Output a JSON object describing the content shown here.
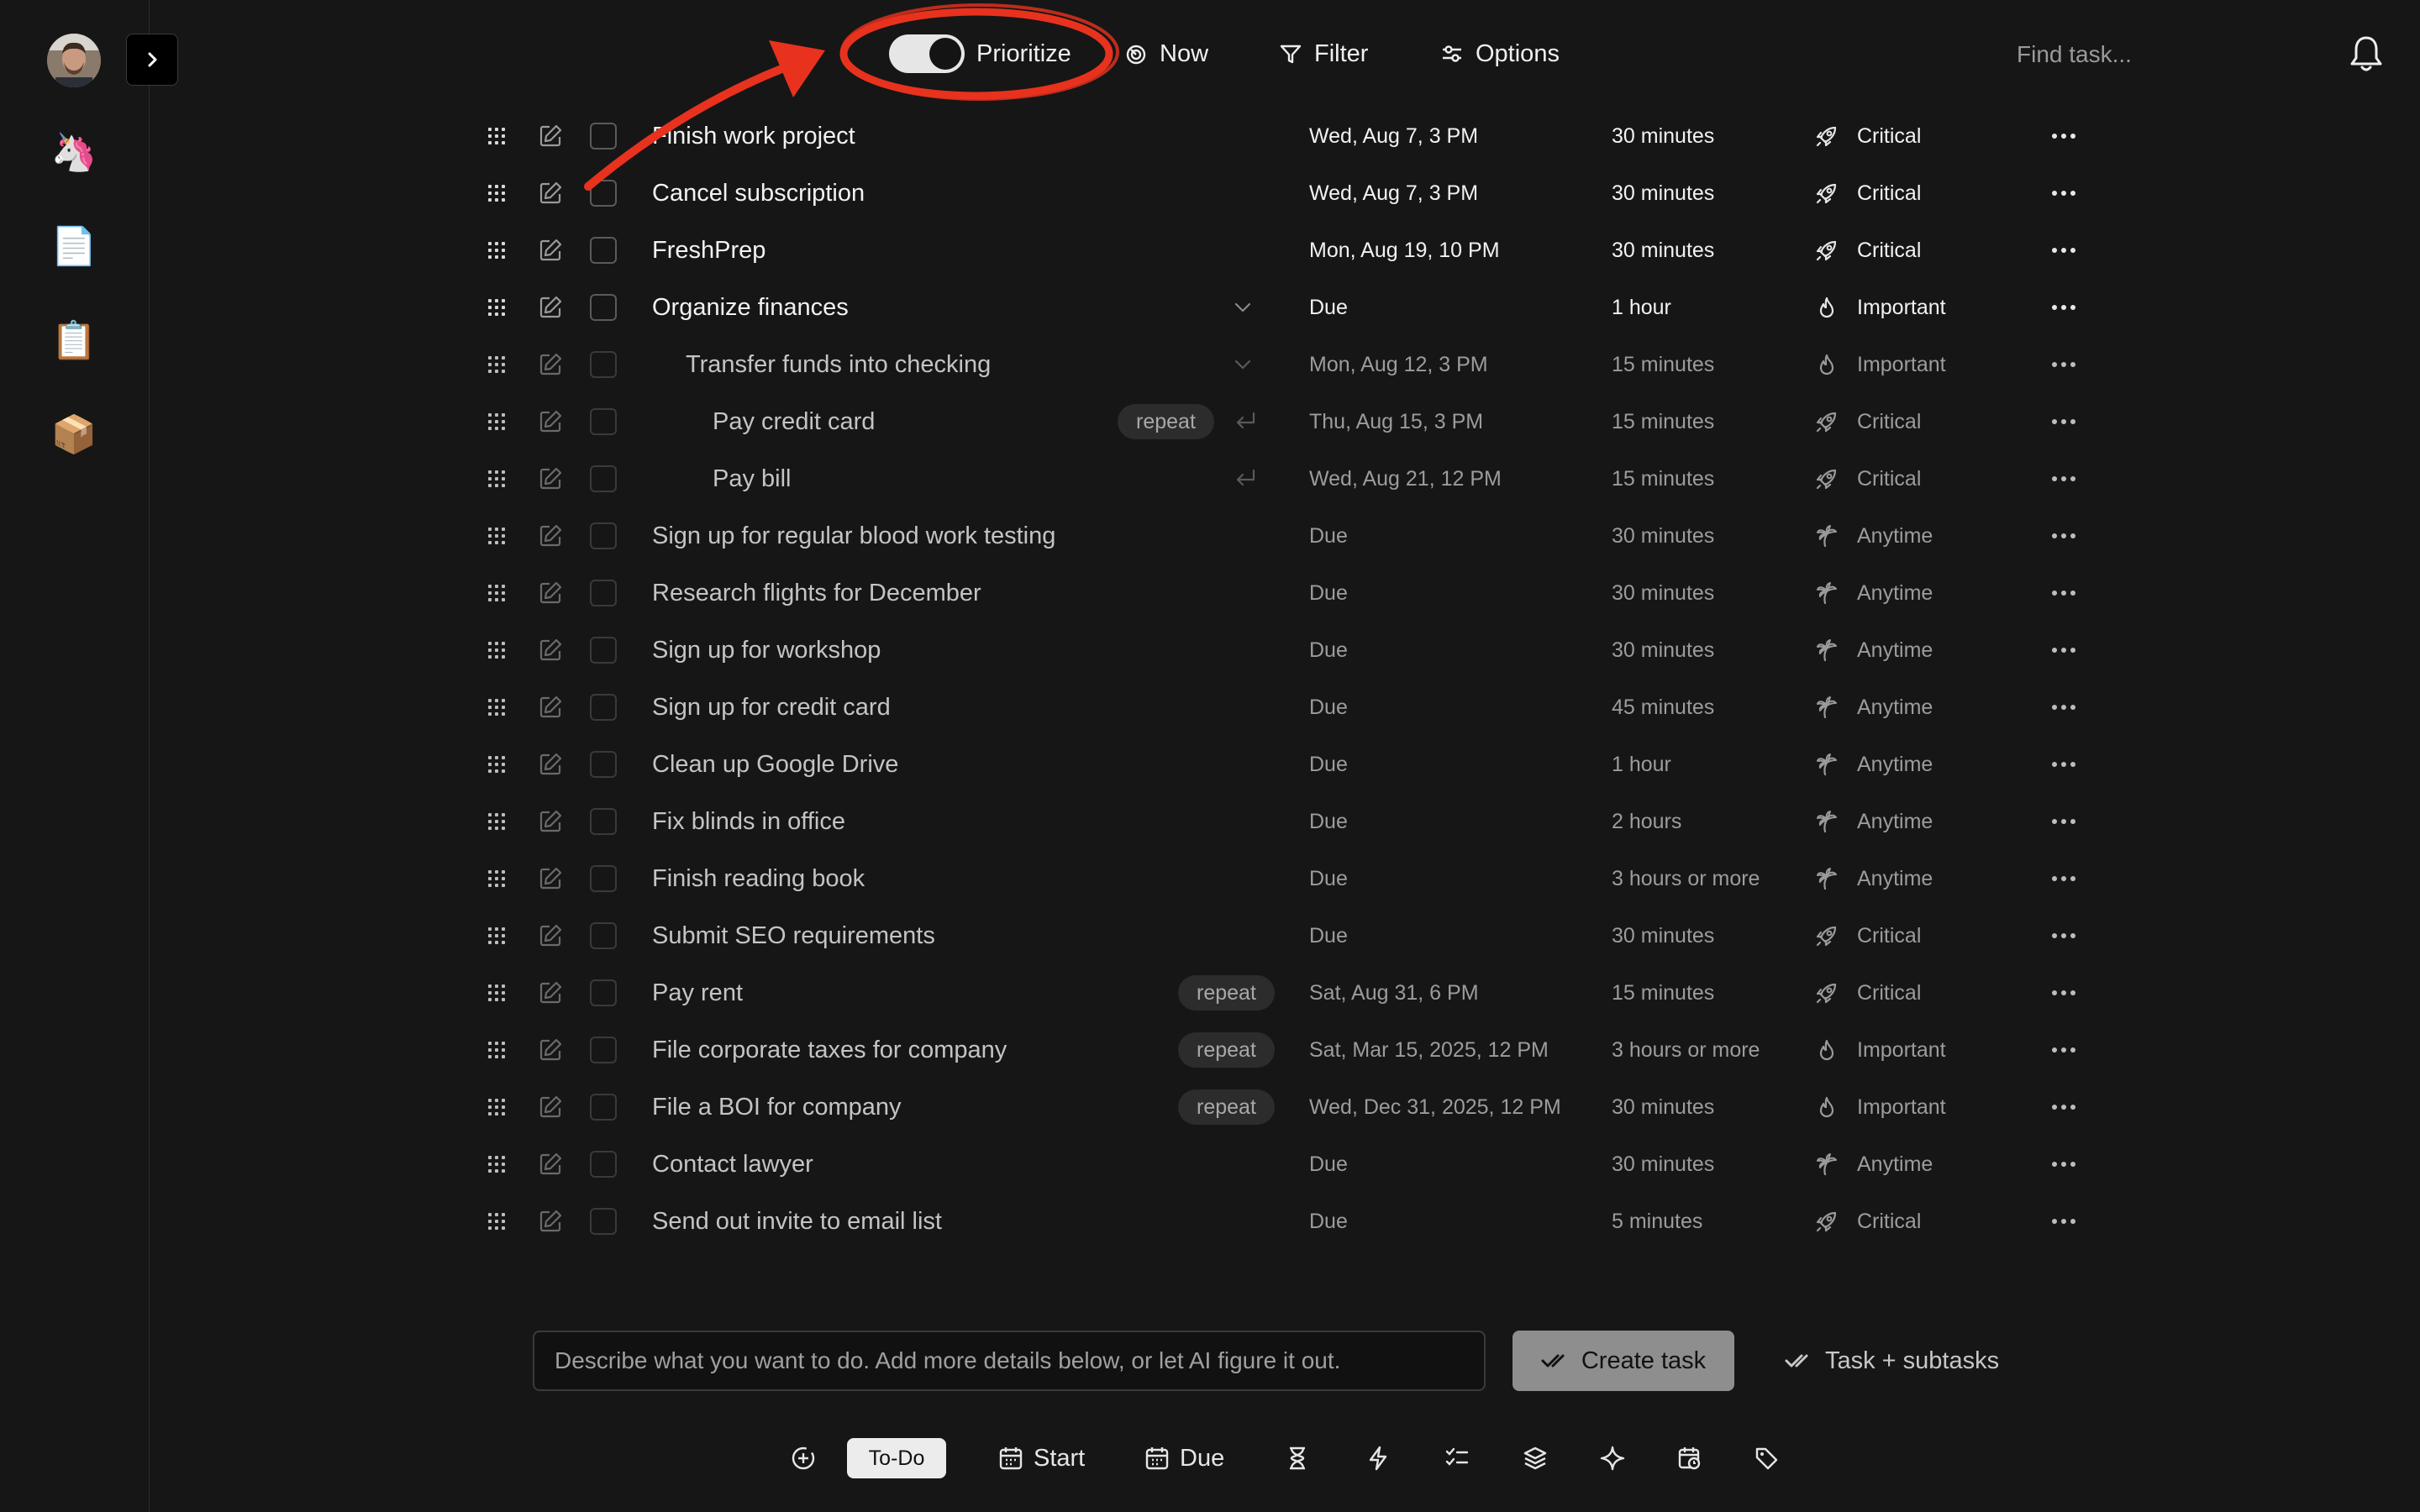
{
  "sidebar": {
    "items": [
      {
        "icon": "unicorn-icon",
        "glyph": "🦄"
      },
      {
        "icon": "page-icon",
        "glyph": "📄"
      },
      {
        "icon": "clipboard-icon",
        "glyph": "📋"
      },
      {
        "icon": "package-icon",
        "glyph": "📦"
      }
    ]
  },
  "topbar": {
    "prioritize_label": "Prioritize",
    "prioritize_on": true,
    "now_label": "Now",
    "filter_label": "Filter",
    "options_label": "Options",
    "search_placeholder": "Find task..."
  },
  "colors": {
    "background": "#161616",
    "annotation_red": "#e8321e",
    "create_button": "#8e8e8e"
  },
  "tasks": [
    {
      "title": "Finish work project",
      "due": "Wed, Aug 7, 3 PM",
      "duration": "30 minutes",
      "priority": "Critical",
      "priority_icon": "rocket-icon",
      "indent": 0,
      "repeat": null,
      "trail": null,
      "bright": true
    },
    {
      "title": "Cancel subscription",
      "due": "Wed, Aug 7, 3 PM",
      "duration": "30 minutes",
      "priority": "Critical",
      "priority_icon": "rocket-icon",
      "indent": 0,
      "repeat": null,
      "trail": null,
      "bright": true
    },
    {
      "title": "FreshPrep",
      "due": "Mon, Aug 19, 10 PM",
      "duration": "30 minutes",
      "priority": "Critical",
      "priority_icon": "rocket-icon",
      "indent": 0,
      "repeat": null,
      "trail": null,
      "bright": true
    },
    {
      "title": "Organize finances",
      "due": "Due",
      "duration": "1 hour",
      "priority": "Important",
      "priority_icon": "flame-icon",
      "indent": 0,
      "repeat": null,
      "trail": "chevron-down-icon",
      "bright": true
    },
    {
      "title": "Transfer funds into checking",
      "due": "Mon, Aug 12, 3 PM",
      "duration": "15 minutes",
      "priority": "Important",
      "priority_icon": "flame-icon",
      "indent": 1,
      "repeat": null,
      "trail": "chevron-down-icon",
      "bright": false
    },
    {
      "title": "Pay credit card",
      "due": "Thu, Aug 15, 3 PM",
      "duration": "15 minutes",
      "priority": "Critical",
      "priority_icon": "rocket-icon",
      "indent": 2,
      "repeat": "repeat",
      "trail": "return-icon",
      "bright": false
    },
    {
      "title": "Pay bill",
      "due": "Wed, Aug 21, 12 PM",
      "duration": "15 minutes",
      "priority": "Critical",
      "priority_icon": "rocket-icon",
      "indent": 2,
      "repeat": null,
      "trail": "return-icon",
      "bright": false
    },
    {
      "title": "Sign up for regular blood work testing",
      "due": "Due",
      "duration": "30 minutes",
      "priority": "Anytime",
      "priority_icon": "palm-tree-icon",
      "indent": 0,
      "repeat": null,
      "trail": null,
      "bright": false
    },
    {
      "title": "Research flights for December",
      "due": "Due",
      "duration": "30 minutes",
      "priority": "Anytime",
      "priority_icon": "palm-tree-icon",
      "indent": 0,
      "repeat": null,
      "trail": null,
      "bright": false
    },
    {
      "title": "Sign up for workshop",
      "due": "Due",
      "duration": "30 minutes",
      "priority": "Anytime",
      "priority_icon": "palm-tree-icon",
      "indent": 0,
      "repeat": null,
      "trail": null,
      "bright": false
    },
    {
      "title": "Sign up for credit card",
      "due": "Due",
      "duration": "45 minutes",
      "priority": "Anytime",
      "priority_icon": "palm-tree-icon",
      "indent": 0,
      "repeat": null,
      "trail": null,
      "bright": false
    },
    {
      "title": "Clean up Google Drive",
      "due": "Due",
      "duration": "1 hour",
      "priority": "Anytime",
      "priority_icon": "palm-tree-icon",
      "indent": 0,
      "repeat": null,
      "trail": null,
      "bright": false
    },
    {
      "title": "Fix blinds in office",
      "due": "Due",
      "duration": "2 hours",
      "priority": "Anytime",
      "priority_icon": "palm-tree-icon",
      "indent": 0,
      "repeat": null,
      "trail": null,
      "bright": false
    },
    {
      "title": "Finish reading book",
      "due": "Due",
      "duration": "3 hours or more",
      "priority": "Anytime",
      "priority_icon": "palm-tree-icon",
      "indent": 0,
      "repeat": null,
      "trail": null,
      "bright": false
    },
    {
      "title": "Submit SEO requirements",
      "due": "Due",
      "duration": "30 minutes",
      "priority": "Critical",
      "priority_icon": "rocket-icon",
      "indent": 0,
      "repeat": null,
      "trail": null,
      "bright": false
    },
    {
      "title": "Pay rent",
      "due": "Sat, Aug 31, 6 PM",
      "duration": "15 minutes",
      "priority": "Critical",
      "priority_icon": "rocket-icon",
      "indent": 0,
      "repeat": "repeat",
      "trail": null,
      "bright": false
    },
    {
      "title": "File corporate taxes for company",
      "due": "Sat, Mar 15, 2025, 12 PM",
      "duration": "3 hours or more",
      "priority": "Important",
      "priority_icon": "flame-icon",
      "indent": 0,
      "repeat": "repeat",
      "trail": null,
      "bright": false
    },
    {
      "title": "File a BOI for company",
      "due": "Wed, Dec 31, 2025, 12 PM",
      "duration": "30 minutes",
      "priority": "Important",
      "priority_icon": "flame-icon",
      "indent": 0,
      "repeat": "repeat",
      "trail": null,
      "bright": false
    },
    {
      "title": "Contact lawyer",
      "due": "Due",
      "duration": "30 minutes",
      "priority": "Anytime",
      "priority_icon": "palm-tree-icon",
      "indent": 0,
      "repeat": null,
      "trail": null,
      "bright": false
    },
    {
      "title": "Send out invite to email list",
      "due": "Due",
      "duration": "5 minutes",
      "priority": "Critical",
      "priority_icon": "rocket-icon",
      "indent": 0,
      "repeat": null,
      "trail": null,
      "bright": false
    }
  ],
  "composer": {
    "placeholder": "Describe what you want to do. Add more details below, or let AI figure it out.",
    "create_label": "Create task",
    "subtasks_label": "Task + subtasks"
  },
  "bottom_toolbar": {
    "todo_label": "To-Do",
    "start_label": "Start",
    "due_label": "Due"
  }
}
